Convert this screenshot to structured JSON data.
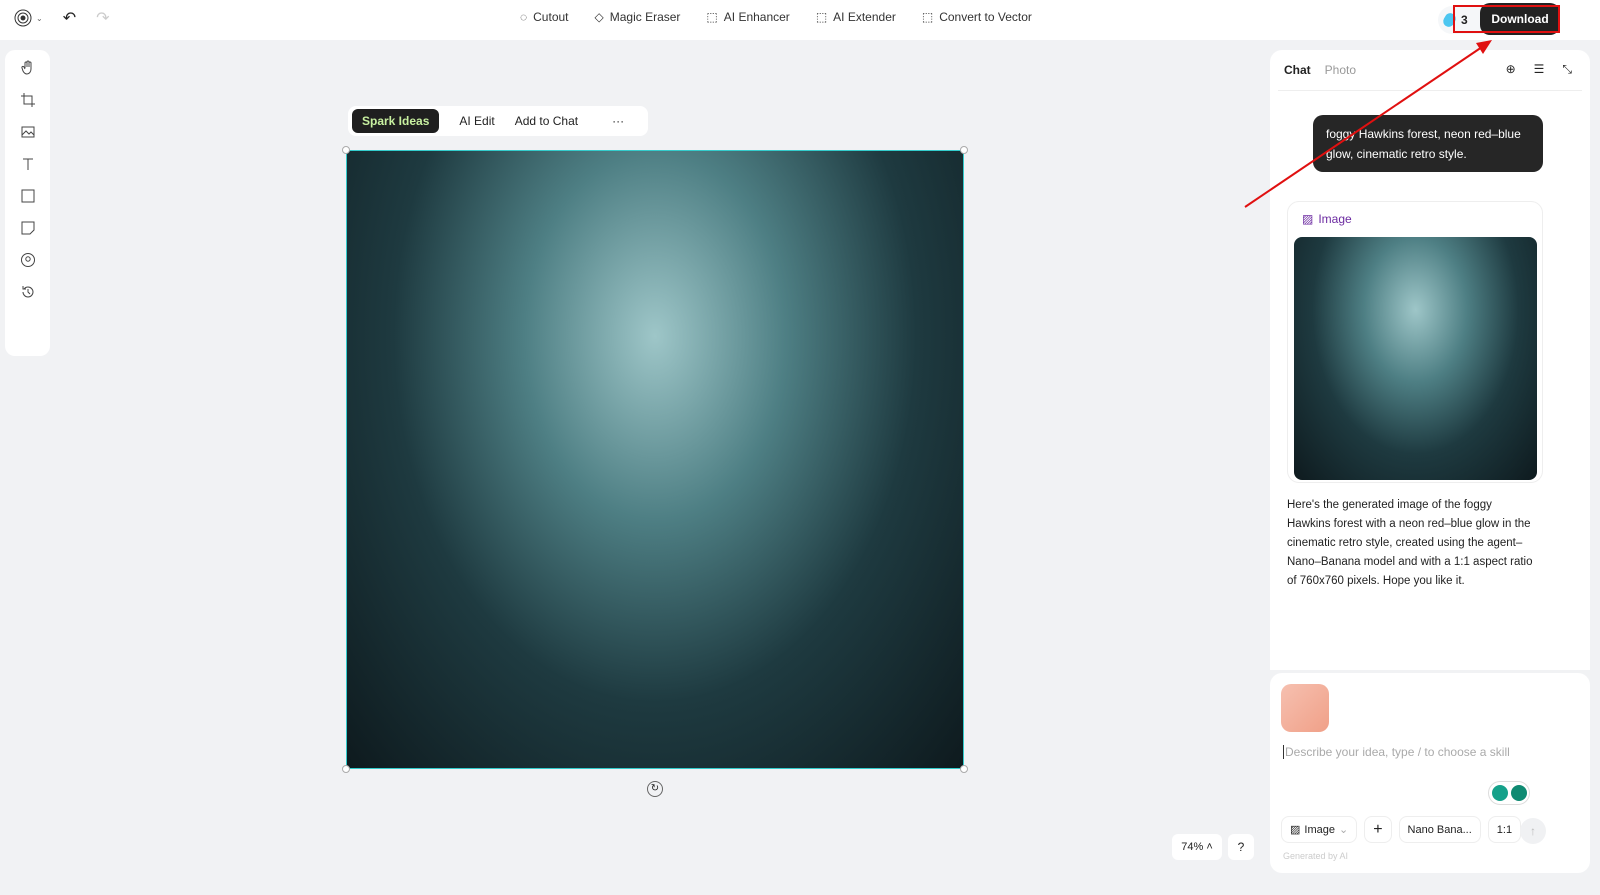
{
  "topbar": {
    "tools": [
      {
        "icon": "cutout-icon",
        "label": "Cutout"
      },
      {
        "icon": "magic-eraser-icon",
        "label": "Magic Eraser"
      },
      {
        "icon": "ai-enhancer-icon",
        "label": "AI Enhancer"
      },
      {
        "icon": "ai-extender-icon",
        "label": "AI Extender"
      },
      {
        "icon": "vector-icon",
        "label": "Convert to Vector"
      }
    ],
    "credits": "3",
    "download": "Download"
  },
  "context_bar": {
    "spark": "Spark Ideas",
    "ai_edit": "AI Edit",
    "add_to_chat": "Add to Chat",
    "more": "···"
  },
  "zoom": "74%",
  "help": "?",
  "panel": {
    "tabs": [
      "Chat",
      "Photo"
    ],
    "user_message": "foggy Hawkins forest, neon red–blue glow, cinematic retro style.",
    "image_label": "Image",
    "reply": "Here's the generated image of the foggy Hawkins forest with a neon red–blue glow in the cinematic retro style, created using the agent–Nano–Banana model and with a 1:1 aspect ratio of 760x760 pixels. Hope you like it."
  },
  "input": {
    "placeholder": "Describe your idea, type / to choose a skill",
    "mode": "Image",
    "model": "Nano Bana...",
    "ratio": "1:1",
    "footer": "Generated by AI"
  },
  "colors": {
    "annotation": "#e01010",
    "accent": "#6b2aa0",
    "selection": "#33cccc"
  }
}
